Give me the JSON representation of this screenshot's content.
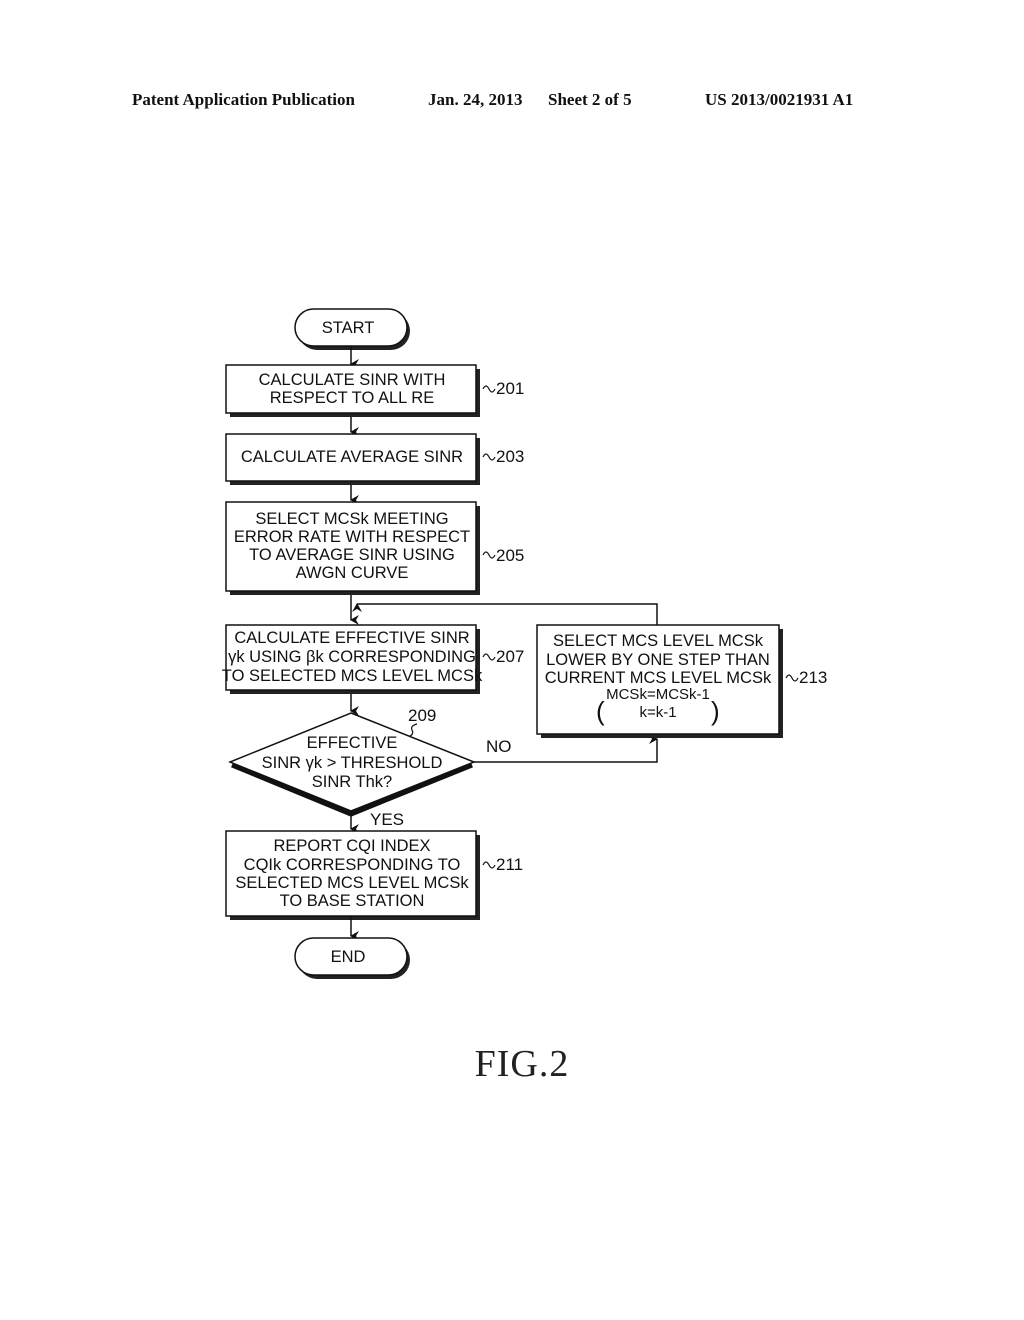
{
  "header": {
    "publication": "Patent Application Publication",
    "date": "Jan. 24, 2013",
    "sheet": "Sheet 2 of 5",
    "number": "US 2013/0021931 A1"
  },
  "flowchart": {
    "start": "START",
    "end": "END",
    "steps": {
      "s201": {
        "ref": "201",
        "lines": [
          "CALCULATE SINR WITH",
          "RESPECT TO ALL RE"
        ]
      },
      "s203": {
        "ref": "203",
        "lines": [
          "CALCULATE AVERAGE SINR"
        ]
      },
      "s205": {
        "ref": "205",
        "lines": [
          "SELECT MCSk MEETING",
          "ERROR RATE WITH RESPECT",
          "TO AVERAGE SINR USING",
          "AWGN CURVE"
        ]
      },
      "s207": {
        "ref": "207",
        "lines": [
          "CALCULATE EFFECTIVE SINR",
          "γk USING βk CORRESPONDING",
          "TO SELECTED MCS LEVEL MCSk"
        ]
      },
      "s209": {
        "ref": "209",
        "lines": [
          "EFFECTIVE",
          "SINR γk > THRESHOLD",
          "SINR Thk?"
        ],
        "yes": "YES",
        "no": "NO"
      },
      "s211": {
        "ref": "211",
        "lines": [
          "REPORT CQI INDEX",
          "CQIk CORRESPONDING TO",
          "SELECTED MCS LEVEL MCSk",
          "TO BASE STATION"
        ]
      },
      "s213": {
        "ref": "213",
        "lines": [
          "SELECT MCS LEVEL MCSk",
          "LOWER BY ONE STEP THAN",
          "CURRENT MCS LEVEL MCSk",
          "MCSk=MCSk-1",
          "k=k-1"
        ]
      }
    }
  },
  "figure_label": "FIG.2"
}
